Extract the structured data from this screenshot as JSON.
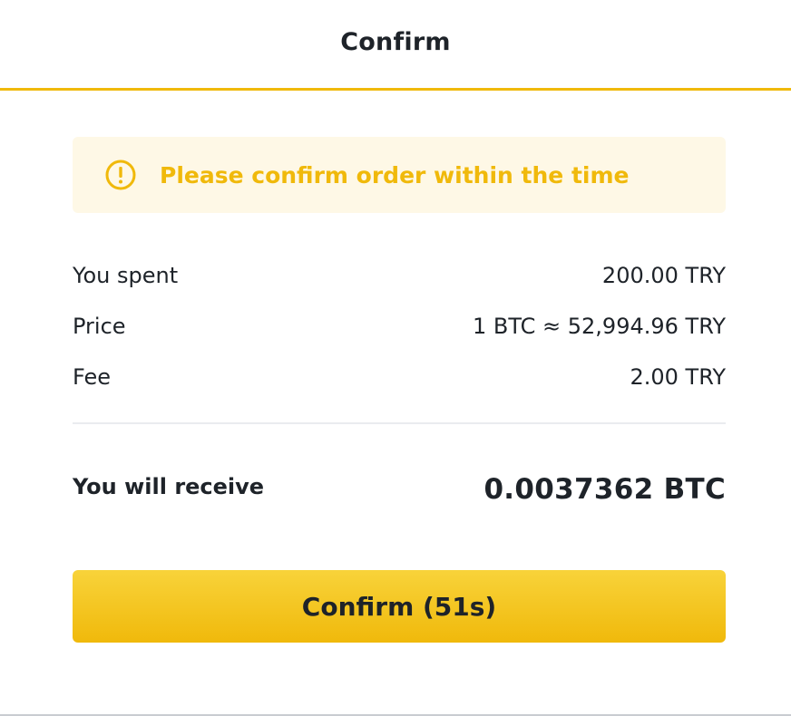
{
  "dialog": {
    "title": "Confirm"
  },
  "notice": {
    "icon": "exclamation-circle-icon",
    "text": "Please confirm order within the time",
    "color": "#f0b90b",
    "background": "#fef8e6"
  },
  "details": [
    {
      "label": "You spent",
      "value": "200.00 TRY"
    },
    {
      "label": "Price",
      "value": "1 BTC ≈ 52,994.96 TRY"
    },
    {
      "label": "Fee",
      "value": "2.00 TRY"
    }
  ],
  "receive": {
    "label": "You will receive",
    "value": "0.0037362 BTC"
  },
  "confirm_button": {
    "label": "Confirm (51s)",
    "color": "#f0b90b"
  }
}
